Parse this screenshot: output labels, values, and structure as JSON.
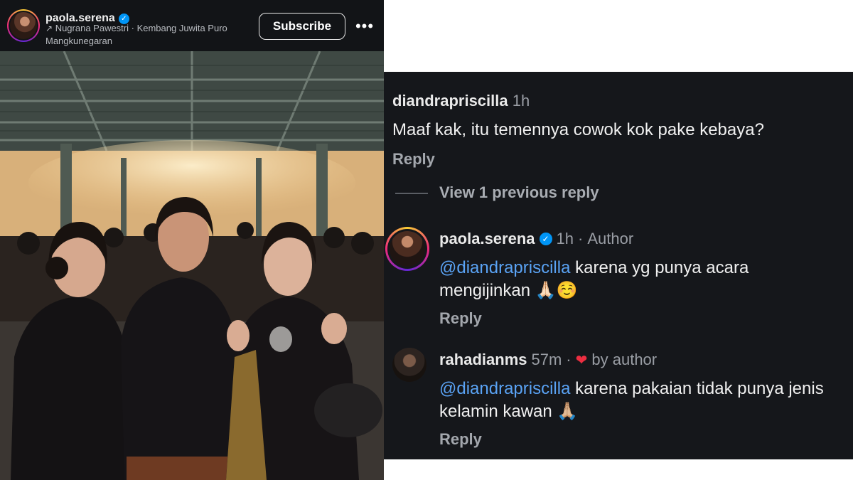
{
  "post": {
    "username": "paola.serena",
    "tagged_line": "Nugrana Pawestri · Kembang Juwita Puro Mangkunegaran",
    "subscribe_label": "Subscribe",
    "more_label": "•••"
  },
  "comments": {
    "view_previous_label": "View 1 previous reply",
    "items": [
      {
        "username": "diandrapriscilla",
        "time": "1h",
        "text": "Maaf kak, itu temennya cowok kok pake kebaya?",
        "reply_label": "Reply"
      },
      {
        "username": "paola.serena",
        "time": "1h",
        "separator": "·",
        "badge": "Author",
        "mention": "@diandrapriscilla",
        "text": "karena yg punya acara mengijinkan 🙏🏻☺️",
        "reply_label": "Reply"
      },
      {
        "username": "rahadianms",
        "time": "57m",
        "separator": "·",
        "badge": "by author",
        "mention": "@diandrapriscilla",
        "text": "karena pakaian tidak punya jenis kelamin kawan 🙏🏼",
        "reply_label": "Reply"
      }
    ]
  },
  "colors": {
    "mention": "#5aa3f5",
    "verified": "#0095f6",
    "heart": "#ed2e41"
  }
}
